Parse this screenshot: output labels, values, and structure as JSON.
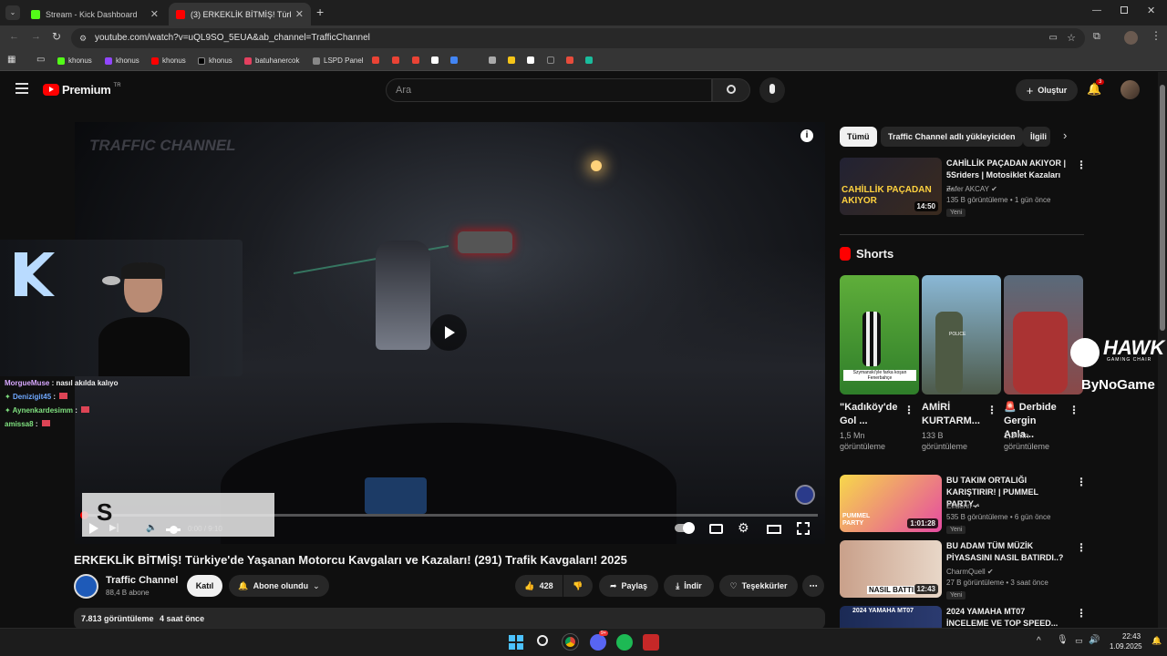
{
  "browser": {
    "tabs": [
      {
        "title": "Stream - Kick Dashboard",
        "active": false
      },
      {
        "title": "(3) ERKEKLİK BİTMİŞ! Türkiye'de",
        "active": true
      }
    ],
    "new_tab": "+",
    "url": "youtube.com/watch?v=uQL9SO_5EUA&ab_channel=TrafficChannel",
    "bookmarks": [
      "khonus",
      "khonus",
      "khonus",
      "khonus",
      "batuhanercok",
      "LSPD Panel"
    ]
  },
  "youtube": {
    "logo_text": "Premium",
    "logo_sup": "TR",
    "search_placeholder": "Ara",
    "create_label": "Oluştur",
    "notification_count": "3"
  },
  "player": {
    "watermark": "TRAFFIC CHANNEL",
    "time": "0:00 / 9:10",
    "overlay_letter": "S"
  },
  "stream_overlay": {
    "chat": [
      {
        "user": "MorgueMuse",
        "msg": ": nasıl akılda kalıyo",
        "color": "#d8a8ff"
      },
      {
        "user": "Denizigit45",
        "msg": ":",
        "color": "#6fa8ff"
      },
      {
        "user": "Aynenkardesimm",
        "msg": ":",
        "color": "#7fe07f"
      },
      {
        "user": "amissa8",
        "msg": ":",
        "color": "#7fe07f"
      }
    ],
    "sponsor_top": "HAWK",
    "sponsor_sub": "GAMING CHAIR",
    "sponsor_bottom": "ByNoGame"
  },
  "video": {
    "title": "ERKEKLİK BİTMİŞ! Türkiye'de Yaşanan Motorcu Kavgaları ve Kazaları! (291) Trafik Kavgaları! 2025",
    "channel": "Traffic Channel",
    "subs": "88,4 B abone",
    "join": "Katıl",
    "subscribed": "Abone olundu",
    "likes": "428",
    "share": "Paylaş",
    "download": "İndir",
    "thanks": "Teşekkürler",
    "more": "⋯",
    "views": "7.813 görüntüleme",
    "ago": "4 saat önce"
  },
  "sidebar": {
    "chips": [
      "Tümü",
      "Traffic Channel adlı yükleyiciden",
      "İlgili"
    ],
    "shorts_title": "Shorts",
    "recs": [
      {
        "title": "CAHİLLİK PAÇADAN AKIYOR | 5Sriders | Motosiklet Kazaları ...",
        "channel": "Zafer AKCAY",
        "meta": "135 B görüntüleme • 1 gün önce",
        "badge": "Yeni",
        "dur": "14:50",
        "thumb_text": "CAHİLLİK PAÇADAN AKIYOR"
      },
      {
        "title": "BU TAKIM ORTALIĞI KARIŞTIRIR! | PUMMEL PARTY...",
        "channel": "Elraenn",
        "meta": "535 B görüntüleme • 6 gün önce",
        "badge": "Yeni",
        "dur": "1:01:28",
        "thumb_text": "PUMMEL PARTY"
      },
      {
        "title": "BU ADAM TÜM MÜZİK PİYASASINI NASIL BATIRDI..?",
        "channel": "CharmQuell",
        "meta": "27 B görüntüleme • 3 saat önce",
        "badge": "Yeni",
        "dur": "12:43",
        "thumb_text": "NASIL BATTI"
      },
      {
        "title": "2024 YAMAHA MT07 İNCELEME VE TOP SPEED...",
        "channel": "",
        "meta": "",
        "badge": "",
        "dur": "",
        "thumb_text": "2024 YAMAHA MT07"
      }
    ],
    "shorts": [
      {
        "title": "\"Kadıköy'de Gol ...",
        "views": "1,5 Mn görüntüleme",
        "caption": "Szymanski'yle farka koşan Fenerbahçe"
      },
      {
        "title": "AMİRİ KURTARM...",
        "views": "133 B görüntüleme",
        "caption": "POLICE"
      },
      {
        "title": "🚨 Derbide Gergin Anla...",
        "views": "1,3 Mn görüntüleme",
        "caption": ""
      }
    ]
  },
  "taskbar": {
    "time": "22:43",
    "date": "1.09.2025",
    "discord_badge": "9+"
  },
  "colors": {
    "accent": "#ff0000",
    "kick": "#53fc18",
    "blue": "#3ea6ff"
  }
}
